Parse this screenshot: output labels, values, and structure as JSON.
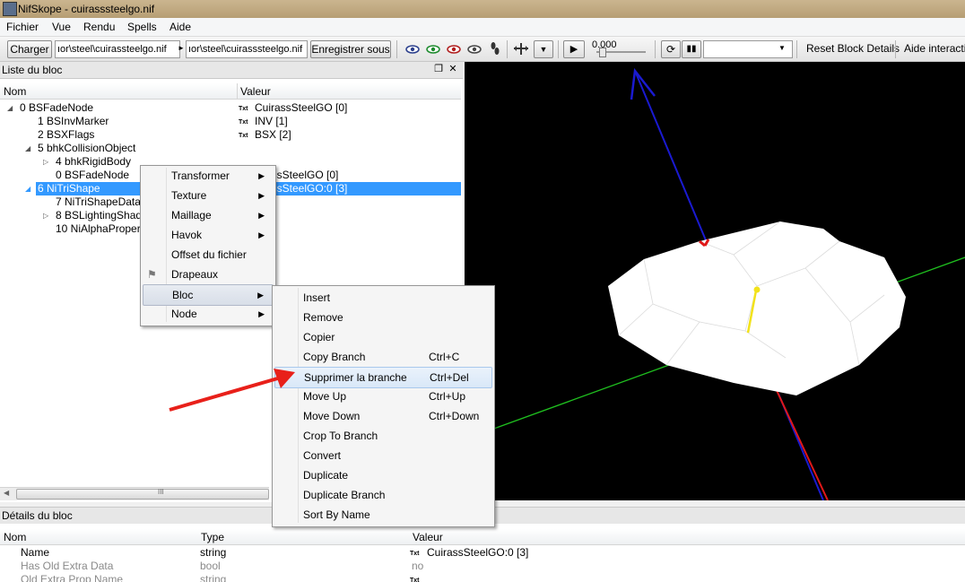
{
  "window": {
    "title": "NifSkope - cuirasssteelgo.nif"
  },
  "menubar": {
    "items": [
      "Fichier",
      "Vue",
      "Rendu",
      "Spells",
      "Aide"
    ]
  },
  "toolbar": {
    "load_label": "Charger",
    "load_path": "ıor\\steel\\cuirassteelgo.nif",
    "save_path": "ıor\\steel\\cuirasssteelgo.nif",
    "save_label": "Enregistrer sous",
    "time_value": "0.000",
    "reset_label": "Reset Block Details",
    "help_label": "Aide interactive"
  },
  "blocklist": {
    "title": "Liste du bloc",
    "columns": [
      "Nom",
      "Valeur"
    ],
    "rows": [
      {
        "name": "0 BSFadeNode",
        "value": "CuirassSteelGO [0]",
        "txt": "Txt"
      },
      {
        "name": "1 BSInvMarker",
        "value": "INV [1]",
        "txt": "Txt"
      },
      {
        "name": "2 BSXFlags",
        "value": "BSX [2]",
        "txt": "Txt"
      },
      {
        "name": "5 bhkCollisionObject",
        "value": "",
        "txt": ""
      },
      {
        "name": "4 bhkRigidBody",
        "value": "",
        "txt": ""
      },
      {
        "name": "0 BSFadeNode",
        "value": "assSteelGO [0]",
        "txt": ""
      },
      {
        "name": "6 NiTriShape",
        "value": "assSteelGO:0 [3]",
        "txt": ""
      },
      {
        "name": "7 NiTriShapeData",
        "value": "",
        "txt": ""
      },
      {
        "name": "8 BSLightingShad",
        "value": "",
        "txt": ""
      },
      {
        "name": "10 NiAlphaProper",
        "value": "",
        "txt": ""
      }
    ],
    "scroll_grip": "III"
  },
  "context_menu": {
    "items": [
      "Transformer",
      "Texture",
      "Maillage",
      "Havok",
      "Offset du fichier",
      "Drapeaux",
      "Bloc",
      "Node"
    ]
  },
  "bloc_submenu": {
    "items": [
      {
        "label": "Insert",
        "shortcut": ""
      },
      {
        "label": "Remove",
        "shortcut": ""
      },
      {
        "label": "Copier",
        "shortcut": ""
      },
      {
        "label": "Copy Branch",
        "shortcut": "Ctrl+C"
      },
      {
        "label": "Supprimer la branche",
        "shortcut": "Ctrl+Del"
      },
      {
        "label": "Move Up",
        "shortcut": "Ctrl+Up"
      },
      {
        "label": "Move Down",
        "shortcut": "Ctrl+Down"
      },
      {
        "label": "Crop To Branch",
        "shortcut": ""
      },
      {
        "label": "Convert",
        "shortcut": ""
      },
      {
        "label": "Duplicate",
        "shortcut": ""
      },
      {
        "label": "Duplicate Branch",
        "shortcut": ""
      },
      {
        "label": "Sort By Name",
        "shortcut": ""
      }
    ]
  },
  "details": {
    "title": "Détails du bloc",
    "columns": [
      "Nom",
      "Type",
      "Valeur"
    ],
    "rows": [
      {
        "name": "Name",
        "type": "string",
        "value": "CuirassSteelGO:0 [3]",
        "txt": "Txt"
      },
      {
        "name": "Has Old Extra Data",
        "type": "bool",
        "value": "no",
        "txt": ""
      },
      {
        "name": "Old Extra Prop Name",
        "type": "string",
        "value": "",
        "txt": "Txt"
      }
    ]
  },
  "colors": {
    "selection": "#3399ff",
    "arrow": "#e8201a",
    "viewport_bg": "#000000"
  }
}
